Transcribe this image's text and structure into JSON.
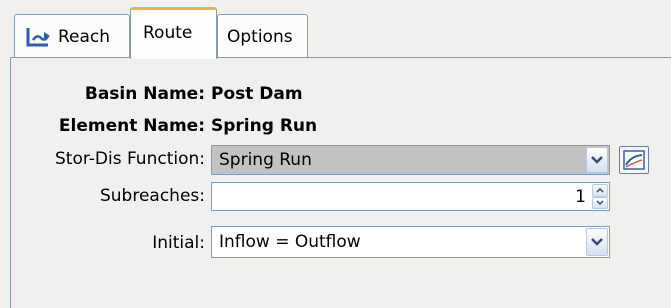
{
  "tabs": [
    {
      "label": "Reach",
      "icon": "reach-icon"
    },
    {
      "label": "Route",
      "selected": true
    },
    {
      "label": "Options"
    }
  ],
  "fields": {
    "basin_name_label": "Basin Name:",
    "basin_name_value": "Post Dam",
    "element_name_label": "Element Name:",
    "element_name_value": "Spring Run",
    "stor_dis_label": "Stor-Dis Function:",
    "stor_dis_value": "Spring Run",
    "subreaches_label": "Subreaches:",
    "subreaches_value": "1",
    "initial_label": "Initial:",
    "initial_value": "Inflow = Outflow"
  },
  "colors": {
    "selected_tab_accent": "#f2b13c",
    "combo_selected_bg": "#c2c2c2",
    "field_border": "#7f9db9"
  }
}
